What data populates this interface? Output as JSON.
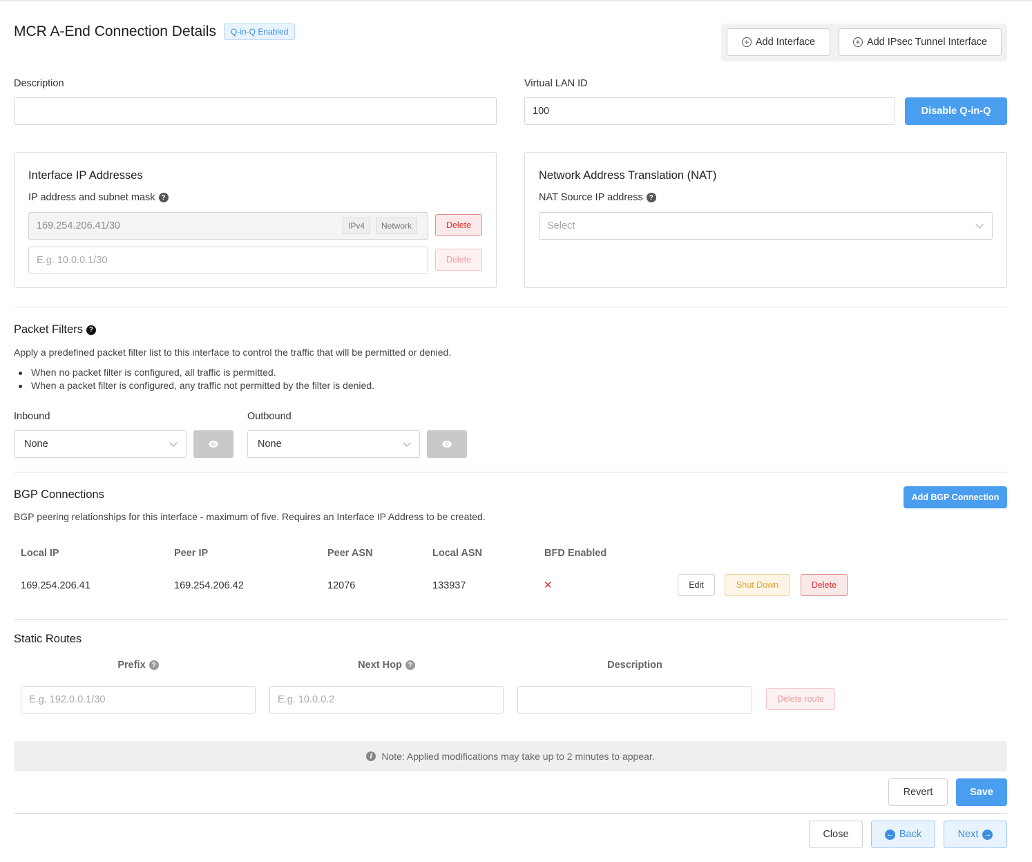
{
  "header": {
    "title": "MCR A-End Connection Details",
    "badge": "Q-in-Q Enabled",
    "add_interface": "Add Interface",
    "add_ipsec": "Add IPsec Tunnel Interface"
  },
  "description": {
    "label": "Description",
    "value": ""
  },
  "vlan": {
    "label": "Virtual LAN ID",
    "value": "100",
    "disable_button": "Disable Q-in-Q"
  },
  "interface_ips": {
    "title": "Interface IP Addresses",
    "field_label": "IP address and subnet mask",
    "rows": [
      {
        "value": "169.254.206.41/30",
        "tags": [
          "IPv4",
          "Network"
        ],
        "delete": "Delete"
      }
    ],
    "new_placeholder": "E.g. 10.0.0.1/30",
    "new_delete": "Delete"
  },
  "nat": {
    "title": "Network Address Translation (NAT)",
    "field_label": "NAT Source IP address",
    "placeholder": "Select"
  },
  "packet_filters": {
    "title": "Packet Filters",
    "description": "Apply a predefined packet filter list to this interface to control the traffic that will be permitted or denied.",
    "bullets": [
      "When no packet filter is configured, all traffic is permitted.",
      "When a packet filter is configured, any traffic not permitted by the filter is denied."
    ],
    "inbound": {
      "label": "Inbound",
      "value": "None"
    },
    "outbound": {
      "label": "Outbound",
      "value": "None"
    }
  },
  "bgp": {
    "title": "BGP Connections",
    "add_button": "Add BGP Connection",
    "description": "BGP peering relationships for this interface - maximum of five. Requires an Interface IP Address to be created.",
    "columns": [
      "Local IP",
      "Peer IP",
      "Peer ASN",
      "Local ASN",
      "BFD Enabled"
    ],
    "rows": [
      {
        "local_ip": "169.254.206.41",
        "peer_ip": "169.254.206.42",
        "peer_asn": "12076",
        "local_asn": "133937",
        "bfd": "✕"
      }
    ],
    "edit": "Edit",
    "shutdown": "Shut Down",
    "delete": "Delete"
  },
  "static_routes": {
    "title": "Static Routes",
    "columns": [
      "Prefix",
      "Next Hop",
      "Description"
    ],
    "prefix_placeholder": "E.g. 192.0.0.1/30",
    "nexthop_placeholder": "E.g. 10.0.0.2",
    "description_value": "",
    "delete_route": "Delete route"
  },
  "note": {
    "icon": "i",
    "text": "Note: Applied modifications may take up to 2 minutes to appear."
  },
  "footer": {
    "revert": "Revert",
    "save": "Save",
    "close": "Close",
    "back": "Back",
    "next": "Next"
  }
}
